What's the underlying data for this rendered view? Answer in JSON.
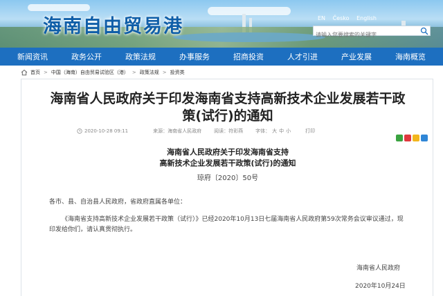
{
  "header": {
    "site_title": "海南自由贸易港",
    "lang_links": [
      "EN",
      "Česko",
      "English"
    ],
    "search": {
      "placeholder": "请输入您要搜索的关键字",
      "value": "请输入您要搜索的关键字"
    }
  },
  "nav": {
    "items": [
      "新闻资讯",
      "政务公开",
      "政策法规",
      "办事服务",
      "招商投资",
      "人才引进",
      "产业发展",
      "海南概览"
    ]
  },
  "breadcrumb": [
    "首页",
    "中国（海南）自由贸易试验区（港）",
    "政策法规",
    "投资类"
  ],
  "article": {
    "headline": "海南省人民政府关于印发海南省支持高新技术企业发展若干政策(试行)的通知",
    "meta": {
      "datetime": "2020-10-28 09:11",
      "source": "来源：海南省人民政府",
      "views": "阅读：符彩燕",
      "font_label": "字体：",
      "font_sizes": [
        "大",
        "中",
        "小"
      ],
      "print": "打印"
    },
    "doc_title_line1": "海南省人民政府关于印发海南省支持",
    "doc_title_line2": "高新技术企业发展若干政策(试行)的通知",
    "doc_number": "琼府〔2020〕50号",
    "salutation": "各市、县、自治县人民政府，省政府直属各单位：",
    "body": "《海南省支持高新技术企业发展若干政策（试行）》已经2020年10月13日七届海南省人民政府第59次常务会议审议通过，现印发给你们，请认真贯彻执行。",
    "signature": "海南省人民政府",
    "date": "2020年10月24日"
  },
  "colors": {
    "nav_bg": "#1d6fc0",
    "title_blue": "#0f5ea8"
  },
  "icons": [
    "home-icon",
    "clock-icon",
    "search-icon",
    "share-wechat-icon",
    "share-weibo-icon",
    "share-qzone-icon",
    "share-more-icon"
  ]
}
